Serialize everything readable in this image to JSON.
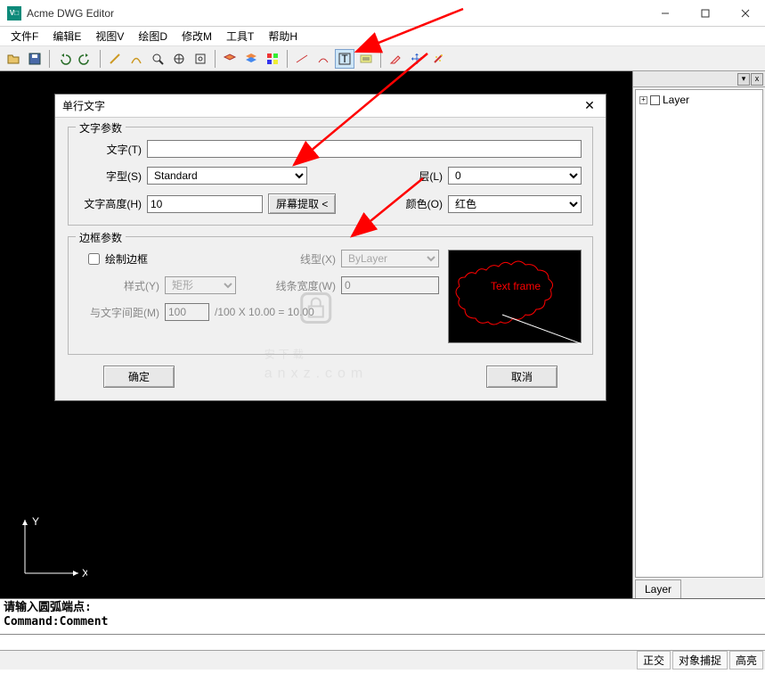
{
  "app": {
    "title": "Acme DWG Editor",
    "icon_text": "V□"
  },
  "menu": [
    "文件F",
    "编辑E",
    "视图V",
    "绘图D",
    "修改M",
    "工具T",
    "帮助H"
  ],
  "toolbar_icons": [
    "open-icon",
    "save-icon",
    "sep",
    "undo-icon",
    "redo-icon",
    "sep",
    "line-icon",
    "arc-icon",
    "zoom-icon",
    "pan-icon",
    "zoom-extents-icon",
    "sep",
    "layer-icon",
    "layers-icon",
    "color-icon",
    "sep",
    "dim-linear-icon",
    "dim-aligned-icon",
    "text-icon",
    "mtext-icon",
    "sep",
    "eraser-icon",
    "move-icon",
    "magic-icon"
  ],
  "dialog": {
    "title": "单行文字",
    "group1_title": "文字参数",
    "text_label": "文字(T)",
    "text_value": "",
    "font_label": "字型(S)",
    "font_value": "Standard",
    "layer_label": "层(L)",
    "layer_value": "0",
    "height_label": "文字高度(H)",
    "height_value": "10",
    "pick_btn": "屏幕提取 <",
    "color_label": "颜色(O)",
    "color_value": "红色",
    "group2_title": "边框参数",
    "draw_frame_label": "绘制边框",
    "linetype_label": "线型(X)",
    "linetype_value": "ByLayer",
    "style_label": "样式(Y)",
    "style_value": "矩形",
    "linewidth_label": "线条宽度(W)",
    "linewidth_value": "0",
    "gap_label": "与文字间距(M)",
    "gap_value": "100",
    "gap_formula": "/100 X 10.00 = 10.00",
    "preview_text": "Text frame",
    "ok": "确定",
    "cancel": "取消"
  },
  "canvas": {
    "x_label": "X",
    "y_label": "Y"
  },
  "right_panel": {
    "root_label": "Layer",
    "tab_label": "Layer"
  },
  "command": {
    "line1": "请输入圆弧端点:",
    "line2": "Command:Comment"
  },
  "status": [
    "正交",
    "对象捕捉",
    "高亮"
  ],
  "watermark": {
    "main": "安下载",
    "sub": "anxz.com"
  }
}
